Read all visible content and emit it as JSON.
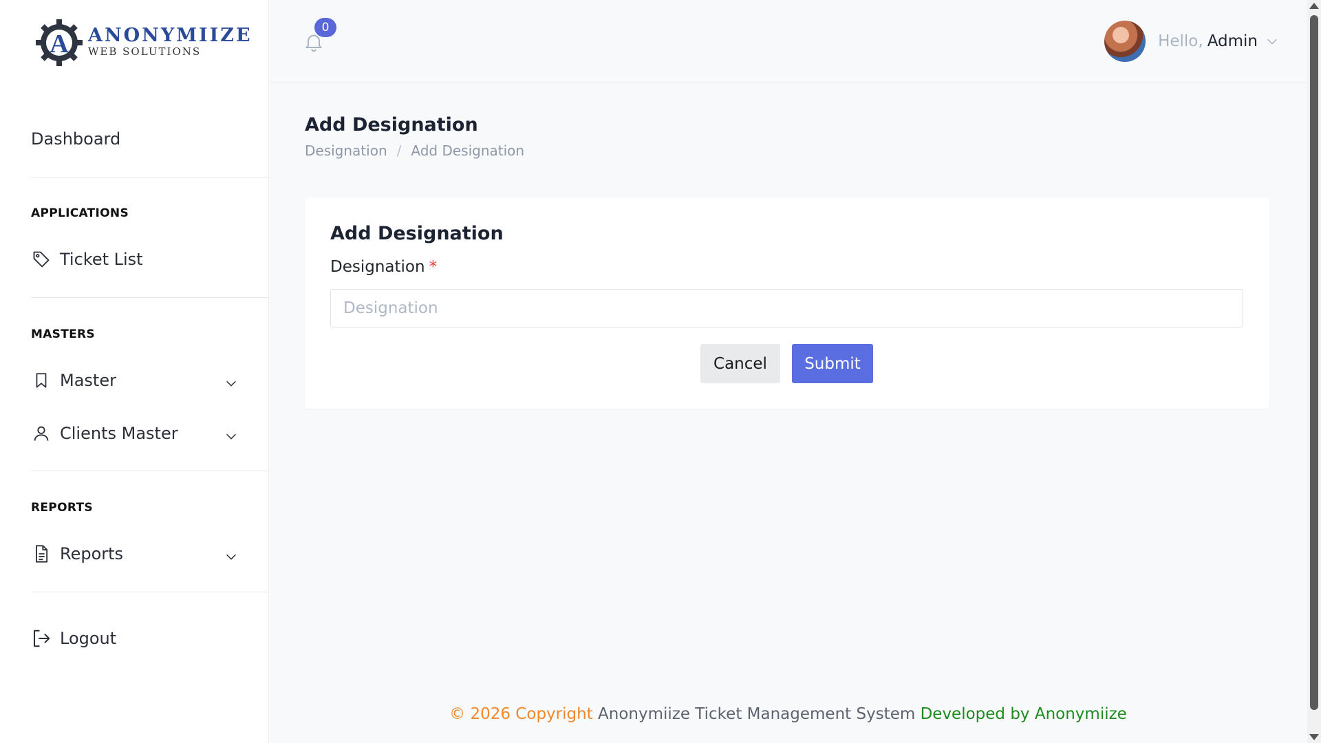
{
  "brand": {
    "title": "ANONYMIIZE",
    "subtitle": "WEB SOLUTIONS",
    "logo_letter": "A",
    "color": "#2a4a9a"
  },
  "sidebar": {
    "dashboard": "Dashboard",
    "sections": {
      "applications": "APPLICATIONS",
      "masters": "MASTERS",
      "reports": "REPORTS"
    },
    "items": {
      "ticket_list": {
        "label": "Ticket List",
        "icon": "tag-icon"
      },
      "master": {
        "label": "Master",
        "icon": "bookmark-icon"
      },
      "clients_master": {
        "label": "Clients Master",
        "icon": "user-icon"
      },
      "reports": {
        "label": "Reports",
        "icon": "document-icon"
      },
      "logout": {
        "label": "Logout",
        "icon": "logout-icon"
      }
    }
  },
  "topbar": {
    "notification_count": "0",
    "greeting": "Hello,",
    "user_name": "Admin"
  },
  "page": {
    "title": "Add Designation",
    "breadcrumb": [
      "Designation",
      "Add Designation"
    ]
  },
  "form": {
    "title": "Add Designation",
    "field_label": "Designation",
    "required_mark": "*",
    "placeholder": "Designation",
    "value": "",
    "cancel_label": "Cancel",
    "submit_label": "Submit"
  },
  "footer": {
    "copyright": "© 2026 Copyright",
    "system": "Anonymiize Ticket Management System",
    "developer": "Developed by Anonymiize"
  },
  "colors": {
    "accent": "#5b6ee1",
    "badge": "#5a67d8",
    "footer_copyright": "#f0892b",
    "footer_developer": "#1f8a1f",
    "required": "#e53e3e"
  }
}
